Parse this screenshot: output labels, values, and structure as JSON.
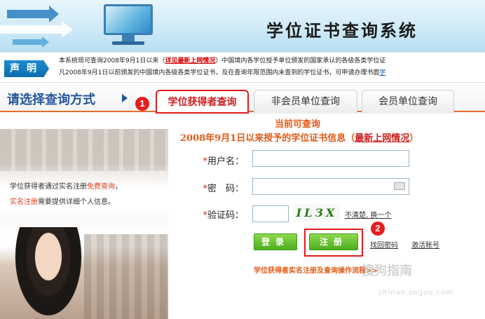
{
  "header": {
    "system_title": "学位证书查询系统"
  },
  "notice": {
    "tag": "声明",
    "line1_prefix": "本系统现可查询2008年9月1日以来（",
    "line1_link": "详见最新上网情况",
    "line1_suffix": "）中国境内各学位授予单位颁发的国家承认的各级各类学位证",
    "line2_prefix": "凡2008年9月1日以前颁发的中国境内各级各类学位证书，及在查询年限范围内未查到的学位证书，可申请办理书面",
    "line2_link": "学"
  },
  "tabs": {
    "choose_label": "请选择查询方式",
    "items": [
      "学位获得者查询",
      "非会员单位查询",
      "会员单位查询"
    ]
  },
  "badges": {
    "one": "1",
    "two": "2"
  },
  "left_panel": {
    "line1_prefix": "学位获得者通过实名注册",
    "line1_red": "免费查询",
    "line1_suffix": "，",
    "line2_red": "实名注册",
    "line2_suffix": "需要提供详细个人信息。"
  },
  "form": {
    "heading1": "当前可查询",
    "heading2_prefix": "2008年9月1日以来授予的学位证书信息（",
    "heading2_link": "最新上网情况",
    "heading2_suffix": "）",
    "star": "*",
    "username_label": "用户名：",
    "password_label": "密　码：",
    "captcha_label": "验证码：",
    "captcha_text": "ILЗX",
    "unclear_link": "不清楚, 换一个",
    "login_button": "登录",
    "register_button": "注册",
    "find_password": "找回密码",
    "activate_account": "激活账号",
    "bottom_link": "学位获得者实名注册及查询操作流程>>"
  },
  "watermark": {
    "text": "搜狗指南",
    "sub": "zhinan.sogou.com"
  }
}
